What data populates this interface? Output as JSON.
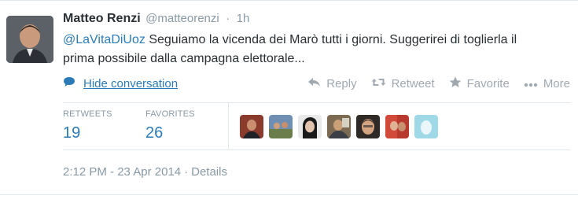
{
  "tweet": {
    "fullname": "Matteo Renzi",
    "username": "@matteorenzi",
    "separator": "·",
    "time": "1h",
    "mention": "@LaVitaDiUoz",
    "text_line1": " Seguiamo la vicenda dei Marò tutti i giorni. Suggerirei di toglierla il",
    "text_line2": "prima possibile dalla campagna elettorale..."
  },
  "conversation": {
    "label": "Hide conversation",
    "icon": "speech-bubble-icon"
  },
  "actions": {
    "reply": "Reply",
    "retweet": "Retweet",
    "favorite": "Favorite",
    "more": "More"
  },
  "stats": {
    "retweets_label": "RETWEETS",
    "retweets_value": "19",
    "favorites_label": "FAVORITES",
    "favorites_value": "26"
  },
  "footer": {
    "timestamp": "2:12 PM - 23 Apr 2014",
    "separator": "·",
    "details": "Details"
  },
  "colors": {
    "link": "#2b7bb9",
    "muted": "#8899a6",
    "text": "#292f33"
  }
}
